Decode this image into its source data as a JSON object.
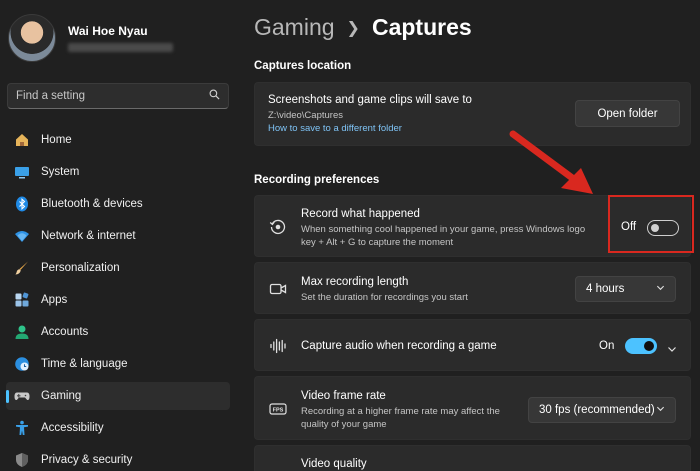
{
  "profile": {
    "name": "Wai Hoe Nyau"
  },
  "search": {
    "placeholder": "Find a setting"
  },
  "nav": [
    {
      "label": "Home",
      "icon": "home-icon"
    },
    {
      "label": "System",
      "icon": "system-icon"
    },
    {
      "label": "Bluetooth & devices",
      "icon": "bluetooth-icon"
    },
    {
      "label": "Network & internet",
      "icon": "wifi-icon"
    },
    {
      "label": "Personalization",
      "icon": "brush-icon"
    },
    {
      "label": "Apps",
      "icon": "apps-icon"
    },
    {
      "label": "Accounts",
      "icon": "accounts-icon"
    },
    {
      "label": "Time & language",
      "icon": "globe-clock-icon"
    },
    {
      "label": "Gaming",
      "icon": "gamepad-icon",
      "active": true
    },
    {
      "label": "Accessibility",
      "icon": "accessibility-icon"
    },
    {
      "label": "Privacy & security",
      "icon": "shield-icon"
    }
  ],
  "breadcrumb": {
    "parent": "Gaming",
    "current": "Captures"
  },
  "captures_location": {
    "section_title": "Captures location",
    "title": "Screenshots and game clips will save to",
    "path": "Z:\\video\\Captures",
    "link": "How to save to a different folder",
    "button": "Open folder"
  },
  "recording_preferences": {
    "section_title": "Recording preferences",
    "record_what_happened": {
      "title": "Record what happened",
      "desc_line1": "When something cool happened in your game, press Windows logo",
      "desc_line2": "key + Alt + G to capture the moment",
      "state_label": "Off",
      "value": false
    },
    "max_recording_length": {
      "title": "Max recording length",
      "desc": "Set the duration for recordings you start",
      "value": "4 hours"
    },
    "capture_audio": {
      "title": "Capture audio when recording a game",
      "state_label": "On",
      "value": true
    },
    "video_frame_rate": {
      "title": "Video frame rate",
      "desc_line1": "Recording at a higher frame rate may affect the",
      "desc_line2": "quality of your game",
      "value": "30 fps (recommended)"
    },
    "video_quality": {
      "title": "Video quality"
    }
  },
  "colors": {
    "accent": "#4cc2ff",
    "annotation": "#d9281f",
    "background": "#202020",
    "card": "#2b2b2b"
  }
}
